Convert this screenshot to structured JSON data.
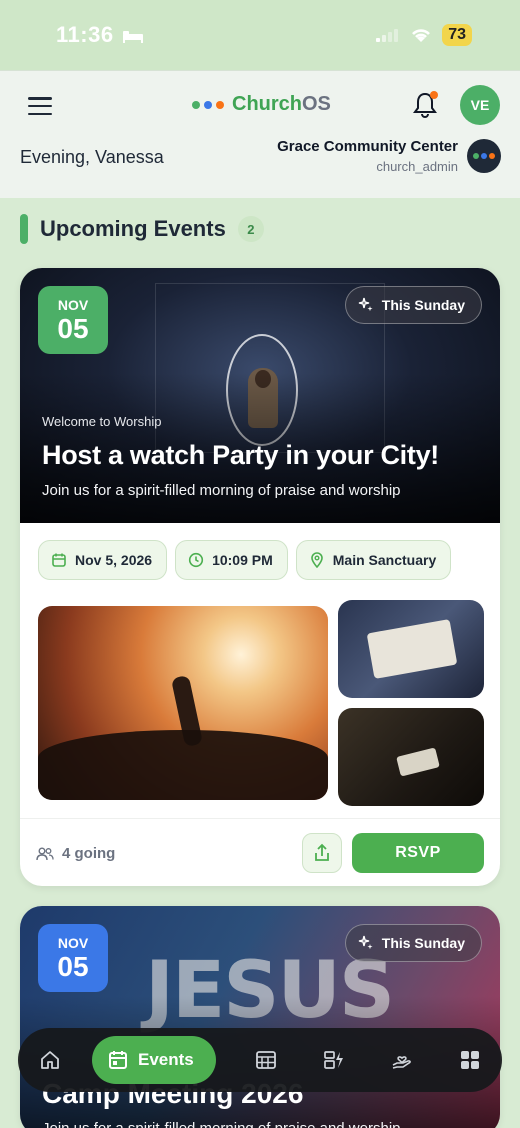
{
  "status_bar": {
    "time": "11:36",
    "battery": "73"
  },
  "header": {
    "brand": {
      "name_part1": "Church",
      "name_part2": "OS"
    },
    "avatar_initials": "VE",
    "greeting": "Evening, Vanessa",
    "org": {
      "name": "Grace Community Center",
      "role": "church_admin"
    }
  },
  "section": {
    "title": "Upcoming Events",
    "count": "2"
  },
  "events": [
    {
      "month": "NOV",
      "day": "05",
      "tag": "This Sunday",
      "subtitle": "Welcome to Worship",
      "title": "Host a watch Party in your City!",
      "description": "Join us for a spirit-filled morning of praise and worship",
      "date": "Nov 5, 2026",
      "time": "10:09 PM",
      "location": "Main Sanctuary",
      "going": "4 going",
      "rsvp_label": "RSVP"
    },
    {
      "month": "NOV",
      "day": "05",
      "tag": "This Sunday",
      "hero_text": "JESUS",
      "title": "Camp Meeting 2026",
      "description": "Join us for a spirit-filled morning of praise and worship"
    }
  ],
  "nav": {
    "active_label": "Events"
  },
  "colors": {
    "accent": "#4caf50",
    "blue_badge": "#3b78e7",
    "brand_green": "#3fa454"
  }
}
